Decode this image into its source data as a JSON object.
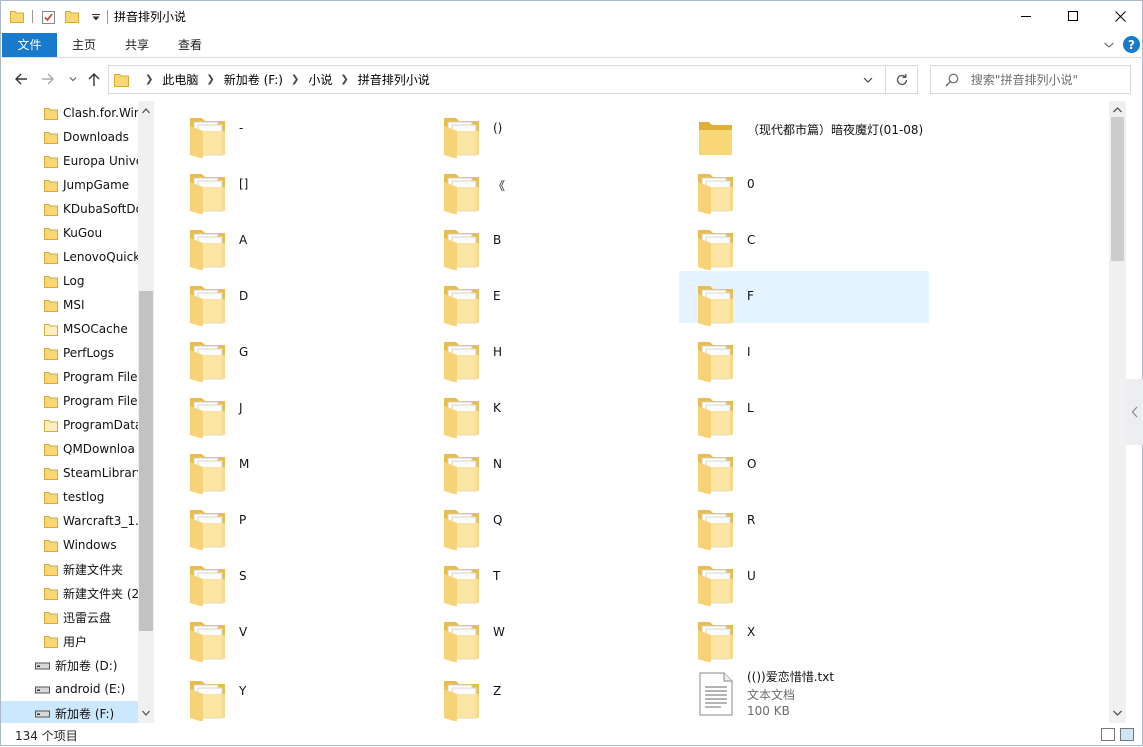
{
  "window": {
    "title": "拼音排列小说",
    "controls": {
      "minimize": "minimize",
      "maximize": "maximize",
      "close": "close"
    }
  },
  "ribbon": {
    "tabs": [
      {
        "label": "文件"
      },
      {
        "label": "主页"
      },
      {
        "label": "共享"
      },
      {
        "label": "查看"
      }
    ]
  },
  "nav": {
    "breadcrumb": [
      "此电脑",
      "新加卷 (F:)",
      "小说",
      "拼音排列小说"
    ],
    "search_placeholder": "搜索\"拼音排列小说\""
  },
  "sidebar": {
    "items": [
      {
        "label": "Clash.for.Win",
        "type": "folder"
      },
      {
        "label": "Downloads",
        "type": "folder"
      },
      {
        "label": "Europa Unive",
        "type": "folder"
      },
      {
        "label": "JumpGame",
        "type": "folder"
      },
      {
        "label": "KDubaSoftDo",
        "type": "folder"
      },
      {
        "label": "KuGou",
        "type": "folder"
      },
      {
        "label": "LenovoQuick",
        "type": "folder"
      },
      {
        "label": "Log",
        "type": "folder"
      },
      {
        "label": "MSI",
        "type": "folder"
      },
      {
        "label": "MSOCache",
        "type": "folder-light"
      },
      {
        "label": "PerfLogs",
        "type": "folder"
      },
      {
        "label": "Program File",
        "type": "folder"
      },
      {
        "label": "Program File",
        "type": "folder"
      },
      {
        "label": "ProgramData",
        "type": "folder-light"
      },
      {
        "label": "QMDownloa",
        "type": "folder"
      },
      {
        "label": "SteamLibrary",
        "type": "folder"
      },
      {
        "label": "testlog",
        "type": "folder"
      },
      {
        "label": "Warcraft3_1.",
        "type": "folder"
      },
      {
        "label": "Windows",
        "type": "folder"
      },
      {
        "label": "新建文件夹",
        "type": "folder"
      },
      {
        "label": "新建文件夹 (2",
        "type": "folder"
      },
      {
        "label": "迅雷云盘",
        "type": "folder"
      },
      {
        "label": "用户",
        "type": "folder"
      },
      {
        "label": "新加卷 (D:)",
        "type": "drive"
      },
      {
        "label": "android (E:)",
        "type": "drive"
      },
      {
        "label": "新加卷 (F:)",
        "type": "drive",
        "selected": true
      }
    ]
  },
  "files": [
    {
      "name": "-",
      "type": "folder"
    },
    {
      "name": "()",
      "type": "folder"
    },
    {
      "name": "（现代都市篇）暗夜魔灯(01-08)",
      "type": "folder-open"
    },
    {
      "name": "[]",
      "type": "folder"
    },
    {
      "name": "《",
      "type": "folder"
    },
    {
      "name": "0",
      "type": "folder"
    },
    {
      "name": "A",
      "type": "folder"
    },
    {
      "name": "B",
      "type": "folder"
    },
    {
      "name": "C",
      "type": "folder"
    },
    {
      "name": "D",
      "type": "folder"
    },
    {
      "name": "E",
      "type": "folder"
    },
    {
      "name": "F",
      "type": "folder",
      "selected": true
    },
    {
      "name": "G",
      "type": "folder"
    },
    {
      "name": "H",
      "type": "folder"
    },
    {
      "name": "I",
      "type": "folder"
    },
    {
      "name": "J",
      "type": "folder"
    },
    {
      "name": "K",
      "type": "folder"
    },
    {
      "name": "L",
      "type": "folder"
    },
    {
      "name": "M",
      "type": "folder"
    },
    {
      "name": "N",
      "type": "folder"
    },
    {
      "name": "O",
      "type": "folder"
    },
    {
      "name": "P",
      "type": "folder"
    },
    {
      "name": "Q",
      "type": "folder"
    },
    {
      "name": "R",
      "type": "folder"
    },
    {
      "name": "S",
      "type": "folder"
    },
    {
      "name": "T",
      "type": "folder"
    },
    {
      "name": "U",
      "type": "folder"
    },
    {
      "name": "V",
      "type": "folder"
    },
    {
      "name": "W",
      "type": "folder"
    },
    {
      "name": "X",
      "type": "folder"
    },
    {
      "name": "Y",
      "type": "folder"
    },
    {
      "name": "Z",
      "type": "folder"
    },
    {
      "name": "(())爱恋惜惜.txt",
      "type": "txt",
      "kind": "文本文档",
      "size": "100 KB"
    }
  ],
  "status": {
    "count": "134 个项目"
  },
  "colors": {
    "accent": "#1979ca",
    "selection": "#cce8ff",
    "hover": "#e5f3ff",
    "folder": "#f8d775"
  }
}
